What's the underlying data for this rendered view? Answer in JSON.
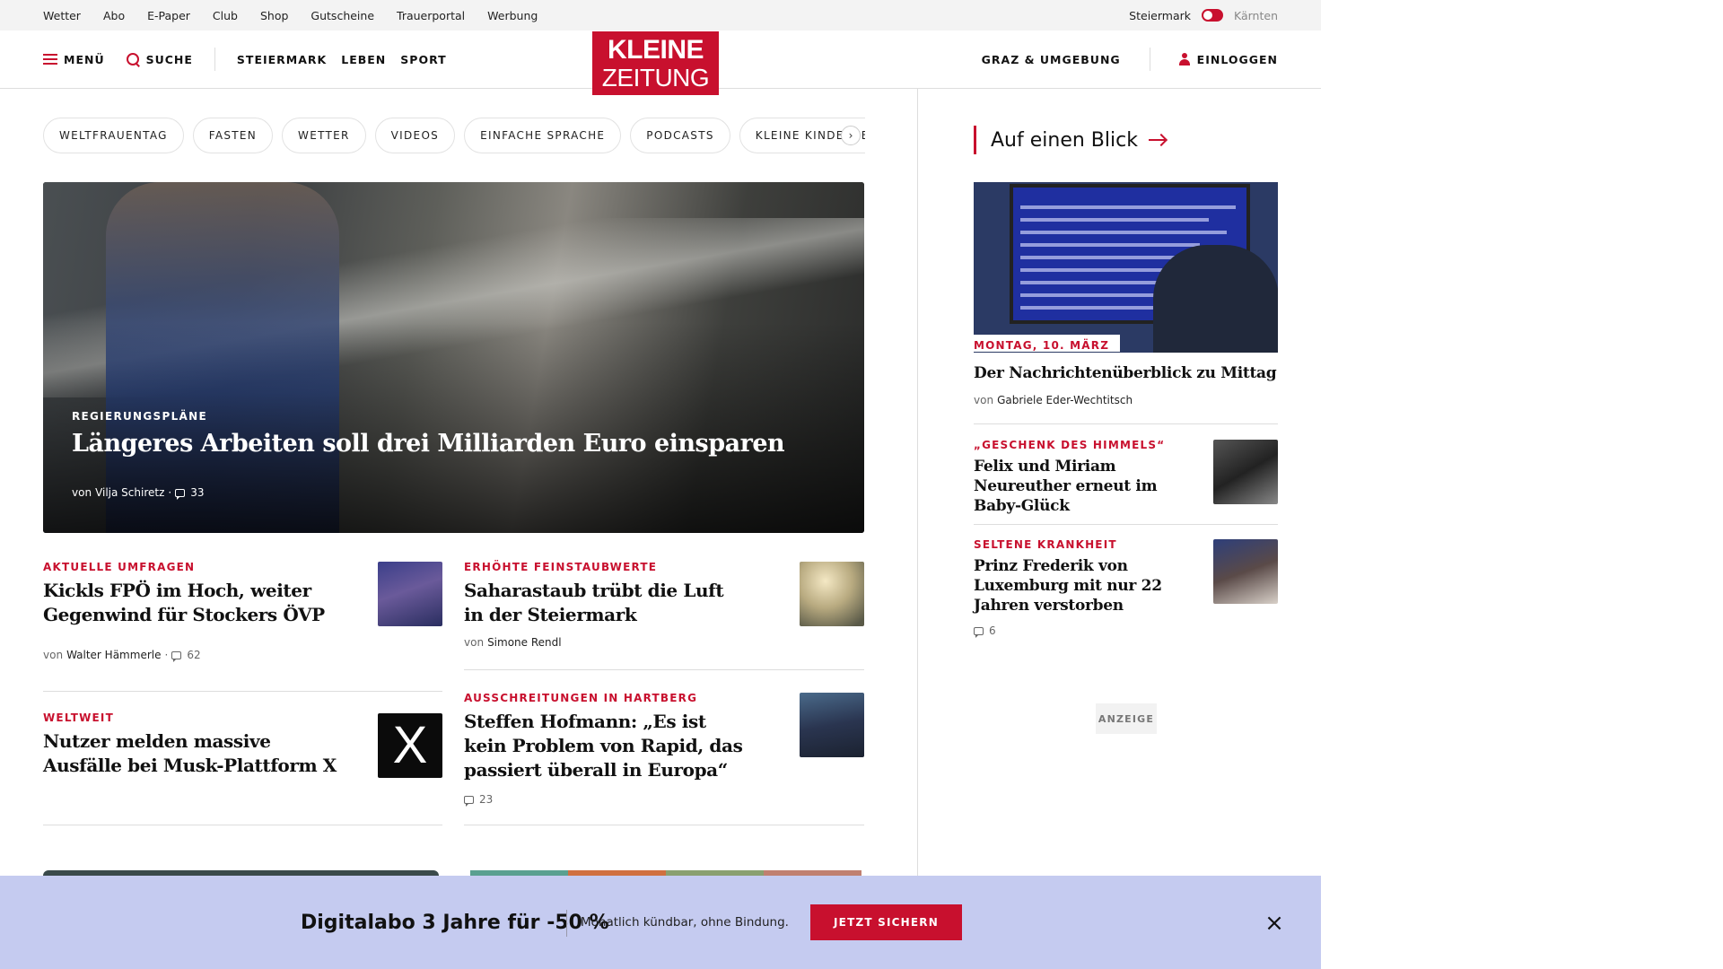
{
  "topbar": {
    "links": [
      "Wetter",
      "Abo",
      "E-Paper",
      "Club",
      "Shop",
      "Gutscheine",
      "Trauerportal",
      "Werbung"
    ],
    "region_active": "Steiermark",
    "region_inactive": "Kärnten"
  },
  "header": {
    "menu_label": "MENÜ",
    "search_label": "SUCHE",
    "nav": [
      "STEIERMARK",
      "LEBEN",
      "SPORT"
    ],
    "logo_line1": "KLEINE",
    "logo_line2": "ZEITUNG",
    "region_link": "GRAZ & UMGEBUNG",
    "login_label": "EINLOGGEN"
  },
  "chips": [
    "WELTFRAUENTAG",
    "FASTEN",
    "WETTER",
    "VIDEOS",
    "EINFACHE SPRACHE",
    "PODCASTS",
    "KLEINE KINDERZEITUNG"
  ],
  "chips_next": "›",
  "hero": {
    "kicker": "REGIERUNGSPLÄNE",
    "title": "Längeres Arbeiten soll drei Milliarden Euro einsparen",
    "author_prefix": "von",
    "author": "Vilja Schiretz",
    "comments": "33"
  },
  "teasers": [
    {
      "kicker": "AKTUELLE UMFRAGEN",
      "title": "Kickls FPÖ im Hoch, weiter Gegenwind für Stockers ÖVP",
      "author_prefix": "von",
      "author": "Walter Hämmerle",
      "comments": "62"
    },
    {
      "kicker": "ERHÖHTE FEINSTAUBWERTE",
      "title": "Saharastaub trübt die Luft in der Steiermark",
      "author_prefix": "von",
      "author": "Simone Rendl"
    },
    {
      "kicker": "WELTWEIT",
      "title": "Nutzer melden massive Ausfälle bei Musk-Plattform X"
    },
    {
      "kicker": "AUSSCHREITUNGEN IN HARTBERG",
      "title": "Steffen Hofmann: „Es ist kein Problem von Rapid, das passiert überall in Europa“",
      "comments": "23"
    }
  ],
  "sidebar": {
    "heading": "Auf einen Blick",
    "lead": {
      "date": "MONTAG, 10. MÄRZ",
      "title": "Der Nachrichtenüberblick zu Mittag",
      "author_prefix": "von",
      "author": "Gabriele Eder-Wechtitsch"
    },
    "items": [
      {
        "kicker": "„GESCHENK DES HIMMELS“",
        "title": "Felix und Miriam Neureuther erneut im Baby-Glück"
      },
      {
        "kicker": "SELTENE KRANKHEIT",
        "title": "Prinz Frederik von Luxemburg mit nur 22 Jahren verstorben",
        "comments": "6"
      }
    ],
    "ad_label": "ANZEIGE"
  },
  "banner": {
    "title": "Digitalabo 3 Jahre für -50 %",
    "subtitle": "Monatlich kündbar, ohne Bindung.",
    "cta": "JETZT SICHERN",
    "close": "×"
  },
  "colors": {
    "brand": "#c8102e",
    "banner_bg": "#c5cbf0"
  }
}
